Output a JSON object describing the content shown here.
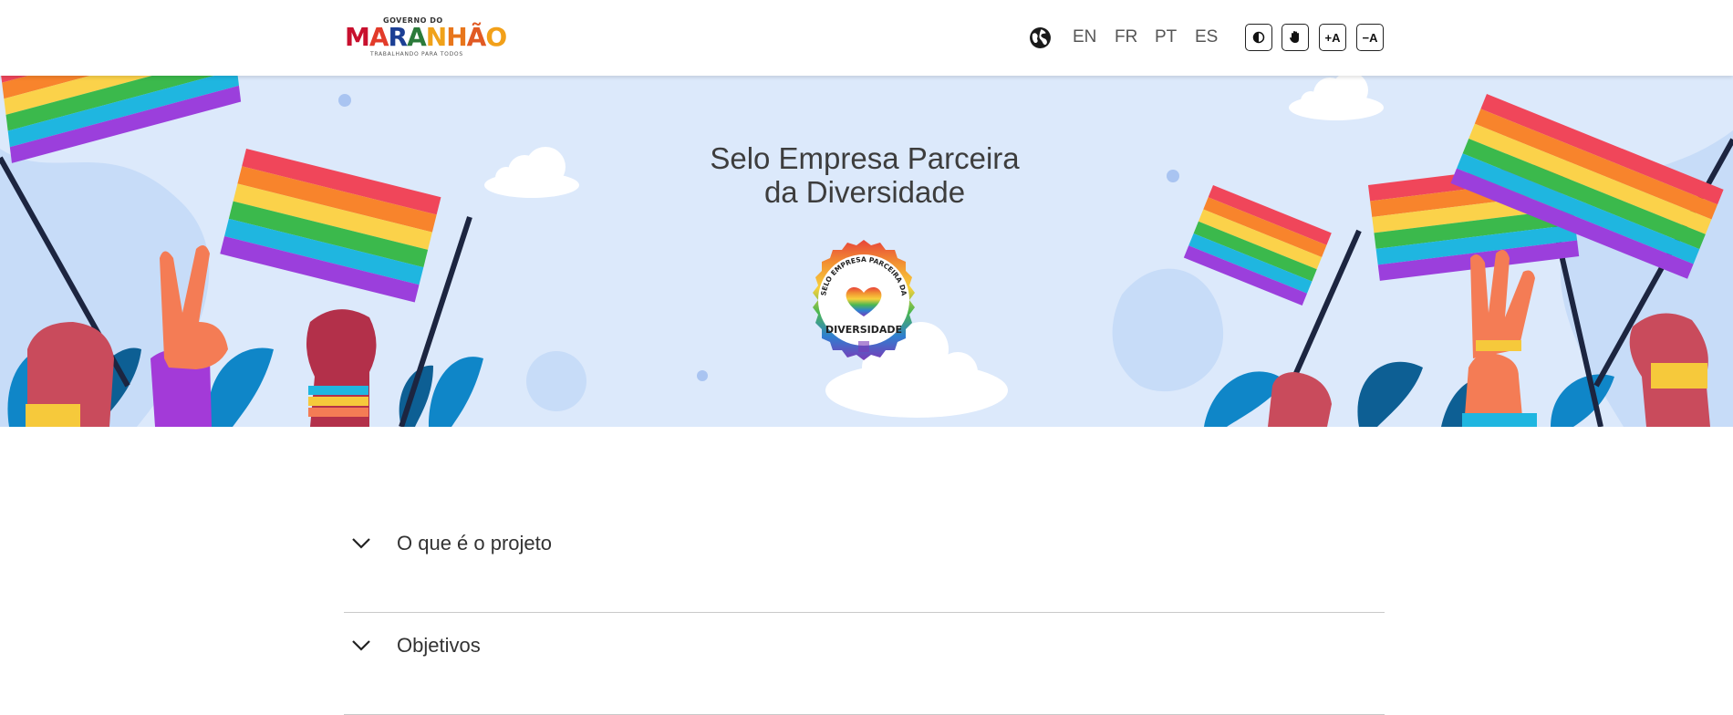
{
  "header": {
    "logo": {
      "top_text": "GOVERNO DO",
      "main_text": "MARANHÃO",
      "sub_text": "TRABALHANDO PARA TODOS"
    },
    "languages": [
      "EN",
      "FR",
      "PT",
      "ES"
    ],
    "accessibility": {
      "contrast_icon": "contrast-icon",
      "libras_icon": "hand-icon",
      "increase_font_label": "+A",
      "decrease_font_label": "−A"
    }
  },
  "hero": {
    "title_line1": "Selo Empresa Parceira",
    "title_line2": "da Diversidade",
    "seal": {
      "top_text": "SELO EMPRESA PARCEIRA DA",
      "bottom_text": "DIVERSIDADE"
    }
  },
  "accordion": [
    {
      "label": "O que é o projeto",
      "icon": "chevron-down-icon"
    },
    {
      "label": "Objetivos",
      "icon": "chevron-down-icon"
    }
  ],
  "colors": {
    "hero_bg": "#dce9fb",
    "text": "#333333",
    "divider": "#c9c9c9"
  }
}
